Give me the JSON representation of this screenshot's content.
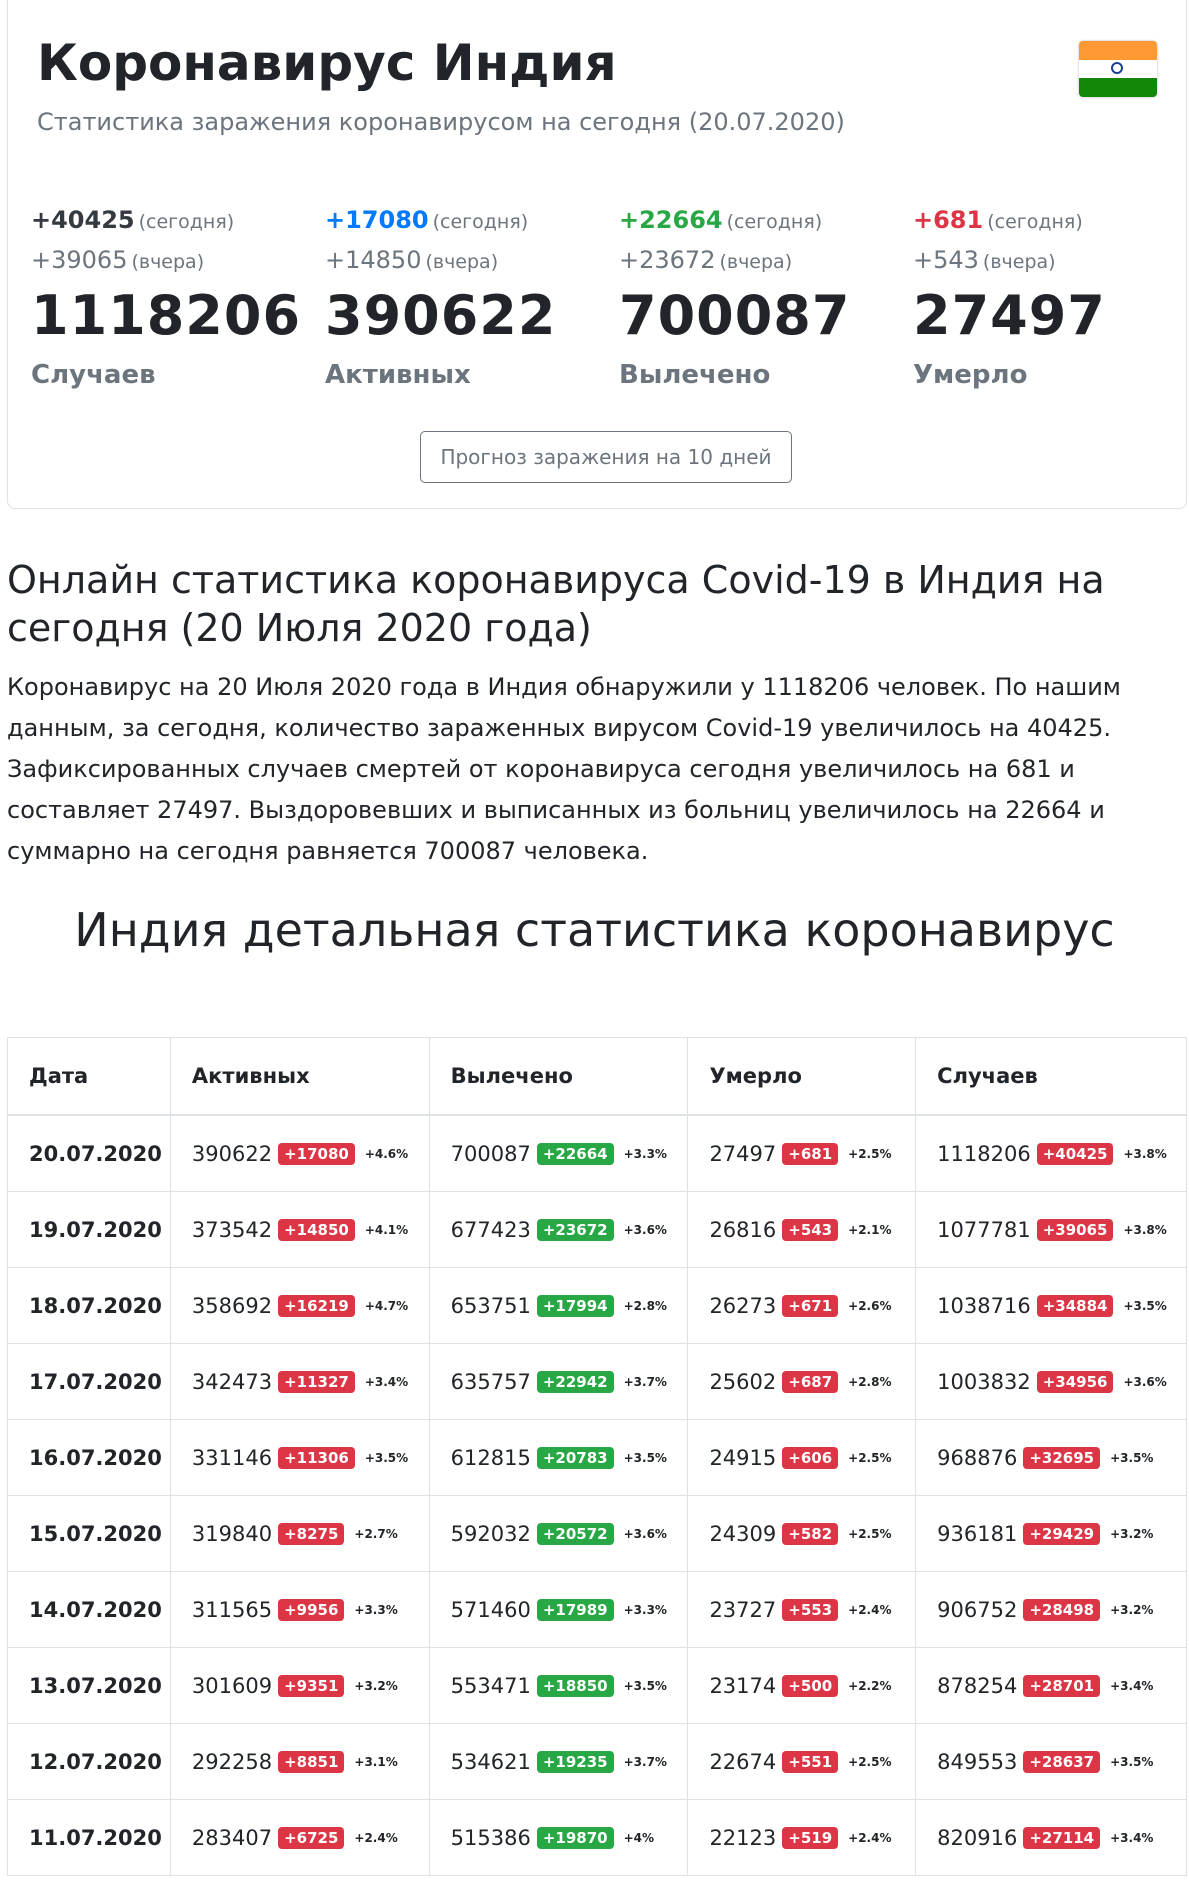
{
  "header": {
    "title": "Коронавирус Индия",
    "subtitle": "Статистика заражения коронавирусом на сегодня (20.07.2020)",
    "flag": "india-flag"
  },
  "stats": [
    {
      "today": "+40425",
      "today_label": "(сегодня)",
      "yesterday": "+39065",
      "yesterday_label": "(вчера)",
      "total": "1118206",
      "name": "Случаев",
      "color": "#343a40"
    },
    {
      "today": "+17080",
      "today_label": "(сегодня)",
      "yesterday": "+14850",
      "yesterday_label": "(вчера)",
      "total": "390622",
      "name": "Активных",
      "color": "#007bff"
    },
    {
      "today": "+22664",
      "today_label": "(сегодня)",
      "yesterday": "+23672",
      "yesterday_label": "(вчера)",
      "total": "700087",
      "name": "Вылечено",
      "color": "#28a745"
    },
    {
      "today": "+681",
      "today_label": "(сегодня)",
      "yesterday": "+543",
      "yesterday_label": "(вчера)",
      "total": "27497",
      "name": "Умерло",
      "color": "#dc3545"
    }
  ],
  "forecast_button": "Прогноз заражения на 10 дней",
  "article": {
    "heading": "Онлайн статистика коронавируса Covid-19 в Индия на сегодня (20 Июля 2020 года)",
    "text": "Коронавирус на 20 Июля 2020 года в Индия обнаружили у 1118206 человек. По нашим данным, за сегодня, количество зараженных вирусом Covid-19 увеличилось на 40425. Зафиксированных случаев смертей от коронавируса сегодня увеличилось на 681 и составляет 27497. Выздоровевших и выписанных из больниц увеличилось на 22664 и суммарно на сегодня равняется 700087 человека."
  },
  "detail_heading": "Индия детальная статистика коронавирус",
  "table": {
    "headers": [
      "Дата",
      "Активных",
      "Вылечено",
      "Умерло",
      "Случаев"
    ],
    "rows": [
      {
        "date": "20.07.2020",
        "active": [
          "390622",
          "+17080",
          "+4.6%"
        ],
        "recovered": [
          "700087",
          "+22664",
          "+3.3%"
        ],
        "deaths": [
          "27497",
          "+681",
          "+2.5%"
        ],
        "cases": [
          "1118206",
          "+40425",
          "+3.8%"
        ]
      },
      {
        "date": "19.07.2020",
        "active": [
          "373542",
          "+14850",
          "+4.1%"
        ],
        "recovered": [
          "677423",
          "+23672",
          "+3.6%"
        ],
        "deaths": [
          "26816",
          "+543",
          "+2.1%"
        ],
        "cases": [
          "1077781",
          "+39065",
          "+3.8%"
        ]
      },
      {
        "date": "18.07.2020",
        "active": [
          "358692",
          "+16219",
          "+4.7%"
        ],
        "recovered": [
          "653751",
          "+17994",
          "+2.8%"
        ],
        "deaths": [
          "26273",
          "+671",
          "+2.6%"
        ],
        "cases": [
          "1038716",
          "+34884",
          "+3.5%"
        ]
      },
      {
        "date": "17.07.2020",
        "active": [
          "342473",
          "+11327",
          "+3.4%"
        ],
        "recovered": [
          "635757",
          "+22942",
          "+3.7%"
        ],
        "deaths": [
          "25602",
          "+687",
          "+2.8%"
        ],
        "cases": [
          "1003832",
          "+34956",
          "+3.6%"
        ]
      },
      {
        "date": "16.07.2020",
        "active": [
          "331146",
          "+11306",
          "+3.5%"
        ],
        "recovered": [
          "612815",
          "+20783",
          "+3.5%"
        ],
        "deaths": [
          "24915",
          "+606",
          "+2.5%"
        ],
        "cases": [
          "968876",
          "+32695",
          "+3.5%"
        ]
      },
      {
        "date": "15.07.2020",
        "active": [
          "319840",
          "+8275",
          "+2.7%"
        ],
        "recovered": [
          "592032",
          "+20572",
          "+3.6%"
        ],
        "deaths": [
          "24309",
          "+582",
          "+2.5%"
        ],
        "cases": [
          "936181",
          "+29429",
          "+3.2%"
        ]
      },
      {
        "date": "14.07.2020",
        "active": [
          "311565",
          "+9956",
          "+3.3%"
        ],
        "recovered": [
          "571460",
          "+17989",
          "+3.3%"
        ],
        "deaths": [
          "23727",
          "+553",
          "+2.4%"
        ],
        "cases": [
          "906752",
          "+28498",
          "+3.2%"
        ]
      },
      {
        "date": "13.07.2020",
        "active": [
          "301609",
          "+9351",
          "+3.2%"
        ],
        "recovered": [
          "553471",
          "+18850",
          "+3.5%"
        ],
        "deaths": [
          "23174",
          "+500",
          "+2.2%"
        ],
        "cases": [
          "878254",
          "+28701",
          "+3.4%"
        ]
      },
      {
        "date": "12.07.2020",
        "active": [
          "292258",
          "+8851",
          "+3.1%"
        ],
        "recovered": [
          "534621",
          "+19235",
          "+3.7%"
        ],
        "deaths": [
          "22674",
          "+551",
          "+2.5%"
        ],
        "cases": [
          "849553",
          "+28637",
          "+3.5%"
        ]
      },
      {
        "date": "11.07.2020",
        "active": [
          "283407",
          "+6725",
          "+2.4%"
        ],
        "recovered": [
          "515386",
          "+19870",
          "+4%"
        ],
        "deaths": [
          "22123",
          "+519",
          "+2.4%"
        ],
        "cases": [
          "820916",
          "+27114",
          "+3.4%"
        ]
      }
    ]
  },
  "colors": {
    "red": "#dc3545",
    "green": "#28a745",
    "blue": "#007bff",
    "muted": "#6c757d"
  }
}
